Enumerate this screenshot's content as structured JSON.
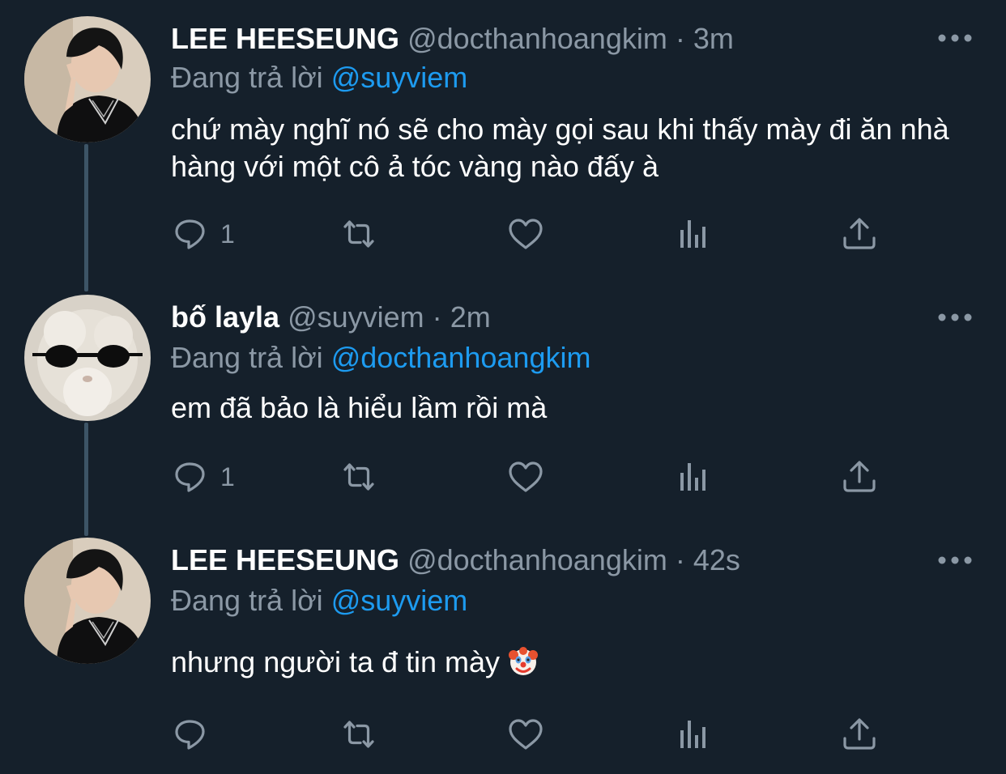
{
  "tweets": [
    {
      "name": "LEE HEESEUNG",
      "handle": "@docthanhoangkim",
      "time": "3m",
      "replying_label": "Đang trả lời",
      "replying_to": "@suyviem",
      "text": "chứ mày nghĩ nó sẽ cho mày gọi sau khi thấy mày đi ăn nhà hàng với một cô ả tóc vàng nào đấy à",
      "reply_count": "1"
    },
    {
      "name": "bố layla",
      "handle": "@suyviem",
      "time": "2m",
      "replying_label": "Đang trả lời",
      "replying_to": "@docthanhoangkim",
      "text": "em đã bảo là hiểu lầm rồi mà",
      "reply_count": "1"
    },
    {
      "name": "LEE HEESEUNG",
      "handle": "@docthanhoangkim",
      "time": "42s",
      "replying_label": "Đang trả lời",
      "replying_to": "@suyviem",
      "text": "nhưng người ta đ tin mày",
      "reply_count": ""
    }
  ],
  "separator": "·",
  "icons": {
    "reply": "reply-icon",
    "retweet": "retweet-icon",
    "like": "heart-icon",
    "analytics": "analytics-icon",
    "share": "share-icon",
    "more": "more-icon",
    "emoji": "clown-face-icon"
  },
  "colors": {
    "background": "#15202b",
    "text": "#ffffff",
    "muted": "#8b98a5",
    "link": "#1d9bf0"
  }
}
